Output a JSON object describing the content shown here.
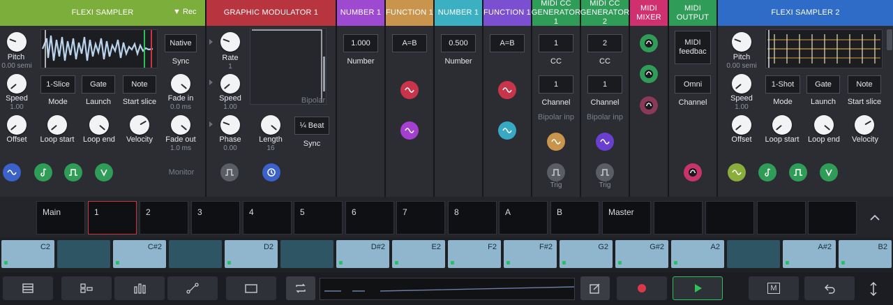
{
  "modules": {
    "flexi1": {
      "title": "FLEXI SAMPLER",
      "rec": "▼ Rec",
      "pitch_label": "Pitch",
      "pitch_value": "0.00 semi",
      "native": "Native",
      "sync": "Sync",
      "speed_label": "Speed",
      "speed_value": "1.00",
      "mode_box": "1-Slice",
      "mode_label": "Mode",
      "launch_box": "Gate",
      "launch_label": "Launch",
      "start_box": "Note",
      "start_label": "Start slice",
      "fadein_label": "Fade in",
      "fadein_value": "0.0 ms",
      "offset_label": "Offset",
      "loopstart_label": "Loop start",
      "loopend_label": "Loop end",
      "velocity_label": "Velocity",
      "fadeout_label": "Fade out",
      "fadeout_value": "1.0 ms",
      "monitor": "Monitor",
      "color": "#7cae3c"
    },
    "gmod": {
      "title": "GRAPHIC MODULATOR 1",
      "rate_label": "Rate",
      "rate_value": "1",
      "speed_label": "Speed",
      "speed_value": "1.00",
      "phase_label": "Phase",
      "phase_value": "0.00",
      "length_label": "Length",
      "length_value": "16",
      "bipolar": "Bipolar",
      "beat_box": "¼ Beat",
      "sync": "Sync",
      "color": "#b8343f"
    },
    "num1": {
      "title": "NUMBER 1",
      "value": "1.000",
      "label": "Number",
      "color": "#9d4ad0"
    },
    "func1": {
      "title": "FUNCTION 1",
      "value": "A=B",
      "color": "#c9944c"
    },
    "num2": {
      "title": "NUMBER 1",
      "value": "0.500",
      "label": "Number",
      "color": "#3bb0c2"
    },
    "func2": {
      "title": "FUNCTION 1",
      "value": "A=B",
      "color": "#7a4fd0"
    },
    "cc1": {
      "title": "MIDI CC GENERATOR 1",
      "cc_value": "1",
      "cc_label": "CC",
      "ch_value": "1",
      "ch_label": "Channel",
      "bipolar": "Bipolar inp",
      "trig": "Trig",
      "color": "#2f9c58"
    },
    "cc2": {
      "title": "MIDI CC GENERATOR 2",
      "cc_value": "2",
      "cc_label": "CC",
      "ch_value": "1",
      "ch_label": "Channel",
      "bipolar": "Bipolar inp",
      "trig": "Trig",
      "color": "#2f9c58"
    },
    "mixer": {
      "title": "MIDI MIXER",
      "color": "#d0306e"
    },
    "output": {
      "title": "MIDI OUTPUT",
      "feedback": "MIDI feedbac",
      "omni": "Omni",
      "channel": "Channel",
      "color": "#2f9c58"
    },
    "flexi2": {
      "title": "FLEXI SAMPLER 2",
      "pitch_label": "Pitch",
      "pitch_value": "0.00 semi",
      "speed_label": "Speed",
      "speed_value": "1.00",
      "mode_box": "1-Shot",
      "mode_label": "Mode",
      "launch_box": "Gate",
      "launch_label": "Launch",
      "start_box": "Note",
      "start_label": "Start slice",
      "offset_label": "Offset",
      "loopstart_label": "Loop start",
      "loopend_label": "Loop end",
      "velocity_label": "Velocity",
      "color": "#2f6cc8"
    }
  },
  "channel_tabs": [
    "Main",
    "1",
    "2",
    "3",
    "4",
    "5",
    "6",
    "7",
    "8",
    "A",
    "B",
    "Master",
    "",
    "",
    "",
    ""
  ],
  "keys": [
    {
      "label": "C2",
      "type": "light",
      "dot": true
    },
    {
      "label": "",
      "type": "dark",
      "dot": false
    },
    {
      "label": "C#2",
      "type": "light",
      "dot": true
    },
    {
      "label": "",
      "type": "dark",
      "dot": false
    },
    {
      "label": "D2",
      "type": "light",
      "dot": true
    },
    {
      "label": "",
      "type": "dark",
      "dot": false
    },
    {
      "label": "D#2",
      "type": "light",
      "dot": true
    },
    {
      "label": "E2",
      "type": "light",
      "dot": true
    },
    {
      "label": "F2",
      "type": "light",
      "dot": true
    },
    {
      "label": "F#2",
      "type": "light",
      "dot": true
    },
    {
      "label": "G2",
      "type": "light",
      "dot": true
    },
    {
      "label": "G#2",
      "type": "light",
      "dot": true
    },
    {
      "label": "A2",
      "type": "light",
      "dot": true
    },
    {
      "label": "",
      "type": "dark",
      "dot": false
    },
    {
      "label": "A#2",
      "type": "light",
      "dot": true
    },
    {
      "label": "B2",
      "type": "light",
      "dot": true
    }
  ],
  "toolbar": {
    "icons": [
      "list-icon",
      "routing-icon",
      "bars-icon",
      "curve-icon",
      "frame-icon",
      "loop-icon",
      "edit-icon",
      "record-icon",
      "play-icon",
      "metronome-icon",
      "undo-icon",
      "resize-icon"
    ],
    "metronome_letter": "M",
    "record_color": "#d8384a",
    "play_color": "#2fc05a"
  }
}
